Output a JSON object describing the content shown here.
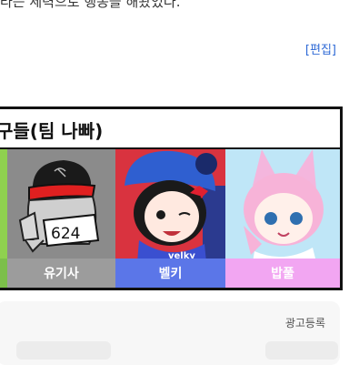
{
  "top_text": "라는 세력으로 행동을 해왔었다.",
  "edit_link": "[편집]",
  "friends": {
    "title": "구들(팀 나빠)",
    "members": [
      {
        "name": "",
        "bg": "#8fd14f",
        "label_bg": "#7cbf4a"
      },
      {
        "name": "유기사",
        "bg": "#8b8b8b",
        "label_bg": "#9c9c9c"
      },
      {
        "name": "벨키",
        "bg": "#d9333f",
        "label_bg": "#5b76e8"
      },
      {
        "name": "밥풀",
        "bg": "#9ed9f2",
        "label_bg": "#f2a6f2"
      }
    ],
    "yugisa_sign": "624"
  },
  "ad": {
    "label": "광고등록"
  }
}
